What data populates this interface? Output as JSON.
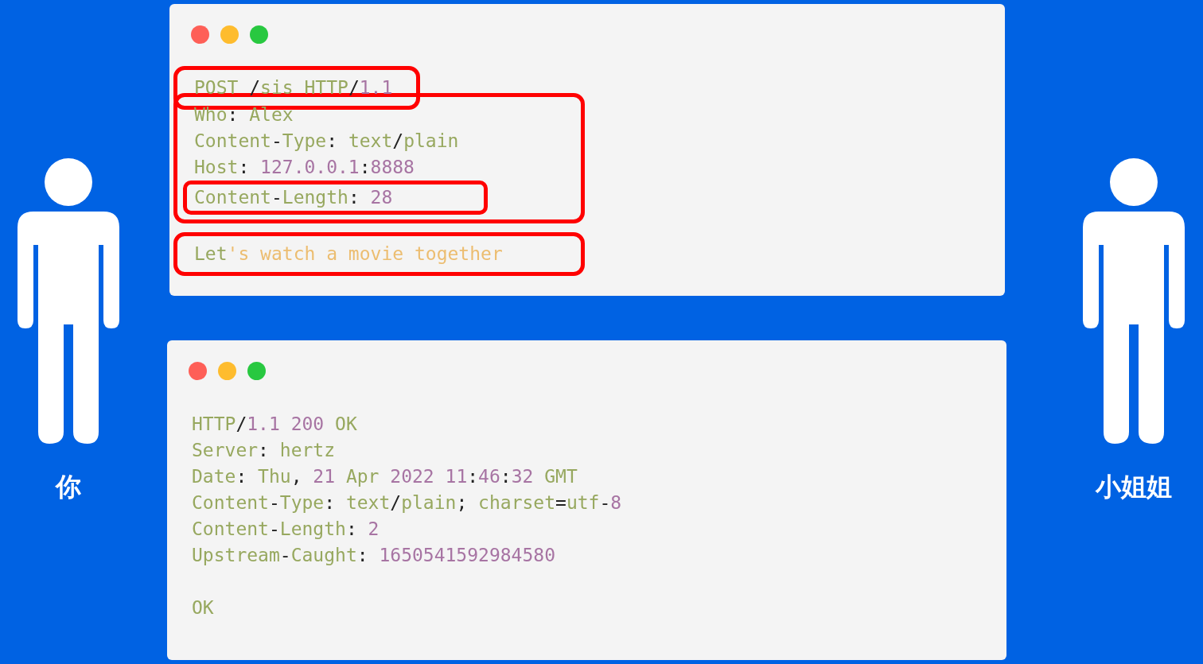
{
  "people": [
    {
      "label": "你"
    },
    {
      "label": "小姐姐"
    }
  ],
  "windows": [
    {
      "blocks": [
        {
          "highlighted": true,
          "lines": [
            {
              "highlighted": false,
              "segments": [
                {
                  "text": "POST ",
                  "kind": "key"
                },
                {
                  "text": "/",
                  "kind": "punct"
                },
                {
                  "text": "sis HTTP",
                  "kind": "key"
                },
                {
                  "text": "/",
                  "kind": "punct"
                },
                {
                  "text": "1.1",
                  "kind": "num"
                }
              ]
            }
          ]
        },
        {
          "highlighted": true,
          "lines": [
            {
              "highlighted": false,
              "segments": [
                {
                  "text": "Who",
                  "kind": "key"
                },
                {
                  "text": ": ",
                  "kind": "punct"
                },
                {
                  "text": "Alex",
                  "kind": "key"
                }
              ]
            },
            {
              "highlighted": false,
              "segments": [
                {
                  "text": "Content",
                  "kind": "key"
                },
                {
                  "text": "-",
                  "kind": "punct"
                },
                {
                  "text": "Type",
                  "kind": "key"
                },
                {
                  "text": ": ",
                  "kind": "punct"
                },
                {
                  "text": "text",
                  "kind": "key"
                },
                {
                  "text": "/",
                  "kind": "punct"
                },
                {
                  "text": "plain",
                  "kind": "key"
                }
              ]
            },
            {
              "highlighted": false,
              "segments": [
                {
                  "text": "Host",
                  "kind": "key"
                },
                {
                  "text": ": ",
                  "kind": "punct"
                },
                {
                  "text": "127.0.0.1",
                  "kind": "num"
                },
                {
                  "text": ":",
                  "kind": "punct"
                },
                {
                  "text": "8888",
                  "kind": "num"
                }
              ]
            },
            {
              "highlighted": true,
              "segments": [
                {
                  "text": "Content",
                  "kind": "key"
                },
                {
                  "text": "-",
                  "kind": "punct"
                },
                {
                  "text": "Length",
                  "kind": "key"
                },
                {
                  "text": ": ",
                  "kind": "punct"
                },
                {
                  "text": "28",
                  "kind": "num"
                }
              ]
            }
          ]
        },
        {
          "highlighted": true,
          "lines": [
            {
              "highlighted": false,
              "segments": [
                {
                  "text": "Let",
                  "kind": "key"
                },
                {
                  "text": "'s watch a movie together",
                  "kind": "str"
                }
              ]
            }
          ]
        }
      ]
    },
    {
      "blocks": [
        {
          "highlighted": false,
          "lines": [
            {
              "highlighted": false,
              "segments": [
                {
                  "text": "HTTP",
                  "kind": "key"
                },
                {
                  "text": "/",
                  "kind": "punct"
                },
                {
                  "text": "1.1 200",
                  "kind": "num"
                },
                {
                  "text": " OK",
                  "kind": "key"
                }
              ]
            },
            {
              "highlighted": false,
              "segments": [
                {
                  "text": "Server",
                  "kind": "key"
                },
                {
                  "text": ": ",
                  "kind": "punct"
                },
                {
                  "text": "hertz",
                  "kind": "key"
                }
              ]
            },
            {
              "highlighted": false,
              "segments": [
                {
                  "text": "Date",
                  "kind": "key"
                },
                {
                  "text": ": ",
                  "kind": "punct"
                },
                {
                  "text": "Thu",
                  "kind": "key"
                },
                {
                  "text": ", ",
                  "kind": "punct"
                },
                {
                  "text": "21",
                  "kind": "num"
                },
                {
                  "text": " Apr ",
                  "kind": "key"
                },
                {
                  "text": "2022 11",
                  "kind": "num"
                },
                {
                  "text": ":",
                  "kind": "punct"
                },
                {
                  "text": "46",
                  "kind": "num"
                },
                {
                  "text": ":",
                  "kind": "punct"
                },
                {
                  "text": "32",
                  "kind": "num"
                },
                {
                  "text": " GMT",
                  "kind": "key"
                }
              ]
            },
            {
              "highlighted": false,
              "segments": [
                {
                  "text": "Content",
                  "kind": "key"
                },
                {
                  "text": "-",
                  "kind": "punct"
                },
                {
                  "text": "Type",
                  "kind": "key"
                },
                {
                  "text": ": ",
                  "kind": "punct"
                },
                {
                  "text": "text",
                  "kind": "key"
                },
                {
                  "text": "/",
                  "kind": "punct"
                },
                {
                  "text": "plain",
                  "kind": "key"
                },
                {
                  "text": "; ",
                  "kind": "punct"
                },
                {
                  "text": "charset",
                  "kind": "key"
                },
                {
                  "text": "=",
                  "kind": "punct"
                },
                {
                  "text": "utf",
                  "kind": "key"
                },
                {
                  "text": "-",
                  "kind": "punct"
                },
                {
                  "text": "8",
                  "kind": "num"
                }
              ]
            },
            {
              "highlighted": false,
              "segments": [
                {
                  "text": "Content",
                  "kind": "key"
                },
                {
                  "text": "-",
                  "kind": "punct"
                },
                {
                  "text": "Length",
                  "kind": "key"
                },
                {
                  "text": ": ",
                  "kind": "punct"
                },
                {
                  "text": "2",
                  "kind": "num"
                }
              ]
            },
            {
              "highlighted": false,
              "segments": [
                {
                  "text": "Upstream",
                  "kind": "key"
                },
                {
                  "text": "-",
                  "kind": "punct"
                },
                {
                  "text": "Caught",
                  "kind": "key"
                },
                {
                  "text": ": ",
                  "kind": "punct"
                },
                {
                  "text": "1650541592984580",
                  "kind": "num"
                }
              ]
            }
          ]
        },
        {
          "highlighted": false,
          "lines": [
            {
              "highlighted": false,
              "segments": [
                {
                  "text": "OK",
                  "kind": "key"
                }
              ]
            }
          ]
        }
      ]
    }
  ]
}
